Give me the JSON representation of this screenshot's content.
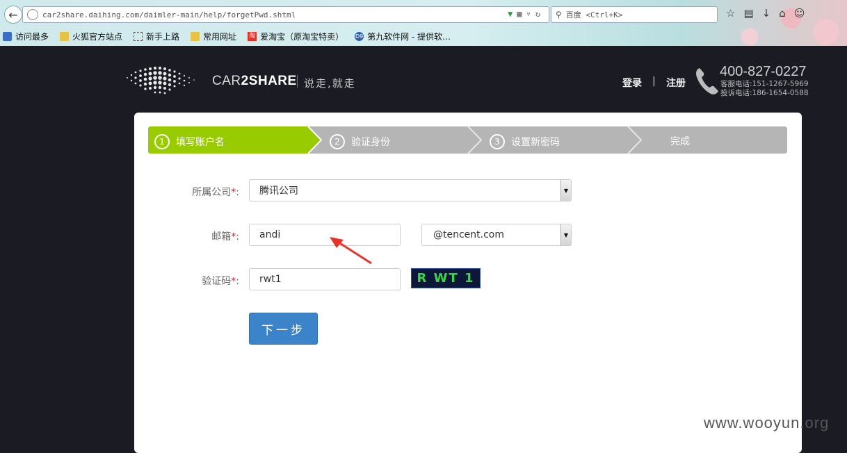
{
  "browser": {
    "url": "car2share.daihing.com/daimler-main/help/forgetPwd.shtml",
    "search_placeholder": "百度 <Ctrl+K>",
    "bookmarks": [
      {
        "label": "访问最多",
        "icon": "bookmark-star-icon"
      },
      {
        "label": "火狐官方站点",
        "icon": "folder-icon"
      },
      {
        "label": "新手上路",
        "icon": "page-icon"
      },
      {
        "label": "常用网址",
        "icon": "folder-icon"
      },
      {
        "label": "爱淘宝（原淘宝特卖）",
        "icon": "taobao-icon"
      },
      {
        "label": "第九软件网 - 提供软…",
        "icon": "d9-icon"
      }
    ]
  },
  "header": {
    "logo_prefix": "CAR",
    "logo_strong": "2SHARE",
    "slogan": "说走,就走",
    "login": "登录",
    "separator": "|",
    "register": "注册",
    "hotline": "400-827-0227",
    "service_phone": "客服电话:151-1267-5969",
    "complaint_phone": "投诉电话:186-1654-0588"
  },
  "steps": [
    {
      "num": "1",
      "label": "填写账户名"
    },
    {
      "num": "2",
      "label": "验证身份"
    },
    {
      "num": "3",
      "label": "设置新密码"
    },
    {
      "num": "",
      "label": "完成"
    }
  ],
  "form": {
    "company_label": "所属公司",
    "company_value": "腾讯公司",
    "email_label": "邮箱",
    "email_value": "andi",
    "domain_value": "@tencent.com",
    "captcha_label": "验证码",
    "captcha_value": "rwt1",
    "captcha_image_text": "R WT 1",
    "required_mark": "*",
    "colon": ":",
    "next_button": "下一步"
  },
  "watermark": "www.wooyun.org",
  "colors": {
    "active_step": "#99cc00",
    "inactive_step": "#b5b5b5",
    "button": "#3c84c9",
    "background": "#1b1c23"
  }
}
